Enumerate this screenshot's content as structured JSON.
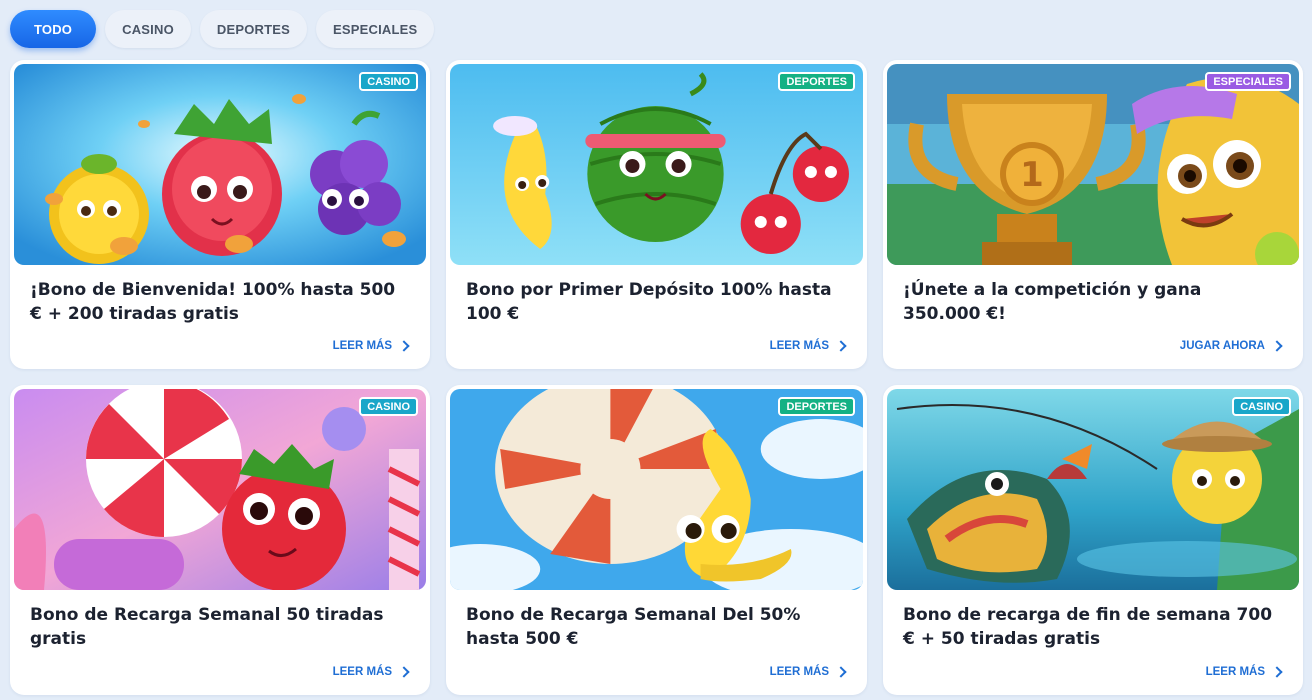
{
  "tabs": [
    {
      "label": "TODO",
      "active": true
    },
    {
      "label": "CASINO",
      "active": false
    },
    {
      "label": "DEPORTES",
      "active": false
    },
    {
      "label": "ESPECIALES",
      "active": false
    }
  ],
  "cards": [
    {
      "badge": "CASINO",
      "title": "¡Bono de Bienvenida! 100% hasta 500 € + 200 tiradas gratis",
      "link": "LEER MÁS",
      "image": "fruits-coins"
    },
    {
      "badge": "DEPORTES",
      "title": "Bono por Primer Depósito 100% hasta 100 €",
      "link": "LEER MÁS",
      "image": "watermelon-banana-cherries"
    },
    {
      "badge": "ESPECIALES",
      "title": "¡Únete a la competición y gana 350.000 €!",
      "link": "JUGAR AHORA",
      "image": "trophy-banana"
    },
    {
      "badge": "CASINO",
      "title": "Bono de Recarga Semanal 50 tiradas gratis",
      "link": "LEER MÁS",
      "image": "candy-strawberry"
    },
    {
      "badge": "DEPORTES",
      "title": "Bono de Recarga Semanal Del 50% hasta 500 €",
      "link": "LEER MÁS",
      "image": "parachute-banana"
    },
    {
      "badge": "CASINO",
      "title": "Bono de recarga de fin de semana 700 € + 50 tiradas gratis",
      "link": "LEER MÁS",
      "image": "fishing-lemon"
    }
  ],
  "colors": {
    "accent": "#1766e6",
    "casino": "#19a6c9",
    "deportes": "#14b184",
    "especiales": "#9a5be3",
    "link": "#1f6ed4"
  }
}
